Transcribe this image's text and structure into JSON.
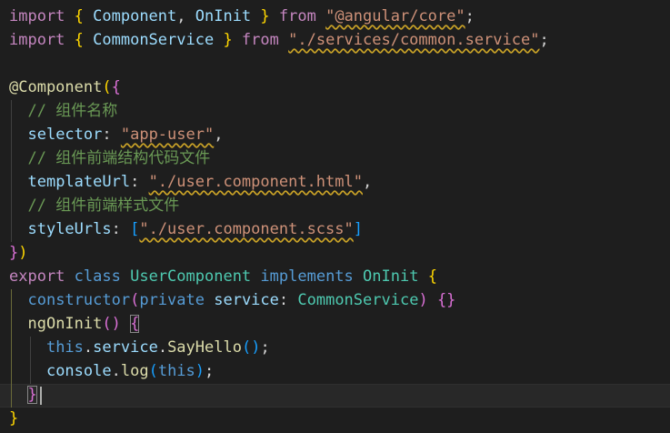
{
  "code": {
    "l1": {
      "kw_import": "import",
      "brace_open": " { ",
      "id1": "Component",
      "comma": ", ",
      "id2": "OnInit",
      "brace_close": " } ",
      "kw_from": "from",
      "space": " ",
      "str": "\"@angular/core\"",
      "semi": ";"
    },
    "l2": {
      "kw_import": "import",
      "brace_open": " { ",
      "id1": "CommonService",
      "brace_close": " } ",
      "kw_from": "from",
      "space": " ",
      "str": "\"./services/common.service\"",
      "semi": ";"
    },
    "l4": {
      "decorator": "@Component",
      "paren": "(",
      "brace": "{"
    },
    "l5": {
      "indent": "  ",
      "comment": "// 组件名称"
    },
    "l6": {
      "indent": "  ",
      "key": "selector",
      "colon": ": ",
      "str": "\"app-user\"",
      "comma": ","
    },
    "l7": {
      "indent": "  ",
      "comment": "// 组件前端结构代码文件"
    },
    "l8": {
      "indent": "  ",
      "key": "templateUrl",
      "colon": ": ",
      "str": "\"./user.component.html\"",
      "comma": ","
    },
    "l9": {
      "indent": "  ",
      "comment": "// 组件前端样式文件"
    },
    "l10": {
      "indent": "  ",
      "key": "styleUrls",
      "colon": ": ",
      "bracket_open": "[",
      "str": "\"./user.component.scss\"",
      "bracket_close": "]"
    },
    "l11": {
      "brace": "}",
      "paren": ")"
    },
    "l12": {
      "kw_export": "export",
      "kw_class": "class",
      "name": "UserComponent",
      "kw_implements": "implements",
      "iface": "OnInit",
      "brace": "{",
      "sp": " "
    },
    "l13": {
      "indent": "  ",
      "kw_constructor": "constructor",
      "paren_open": "(",
      "kw_private": "private",
      "sp": " ",
      "param": "service",
      "colon": ": ",
      "type": "CommonService",
      "paren_close": ")",
      "braces": "{}"
    },
    "l14": {
      "indent": "  ",
      "fn": "ngOnInit",
      "parens": "()",
      "sp": " ",
      "brace": "{"
    },
    "l15": {
      "indent": "    ",
      "kw_this": "this",
      "dot": ".",
      "prop": "service",
      "method": "SayHello",
      "parens": "()",
      "semi": ";"
    },
    "l16": {
      "indent": "    ",
      "obj": "console",
      "dot": ".",
      "method": "log",
      "paren_open": "(",
      "kw_this": "this",
      "paren_close": ")",
      "semi": ";"
    },
    "l17": {
      "indent": "  ",
      "brace": "}"
    },
    "l18": {
      "brace": "}"
    }
  },
  "colors": {
    "background": "#1e1e1e",
    "keyword_control": "#c586c0",
    "keyword": "#569cd6",
    "class_name": "#4ec9b0",
    "variable": "#9cdcfe",
    "function": "#dcdcaa",
    "string": "#ce9178",
    "comment": "#6a9955",
    "bracket_level1": "#ffd700",
    "bracket_level2": "#da70d6",
    "bracket_level3": "#179fff",
    "squiggle_warning": "#c9a227"
  }
}
